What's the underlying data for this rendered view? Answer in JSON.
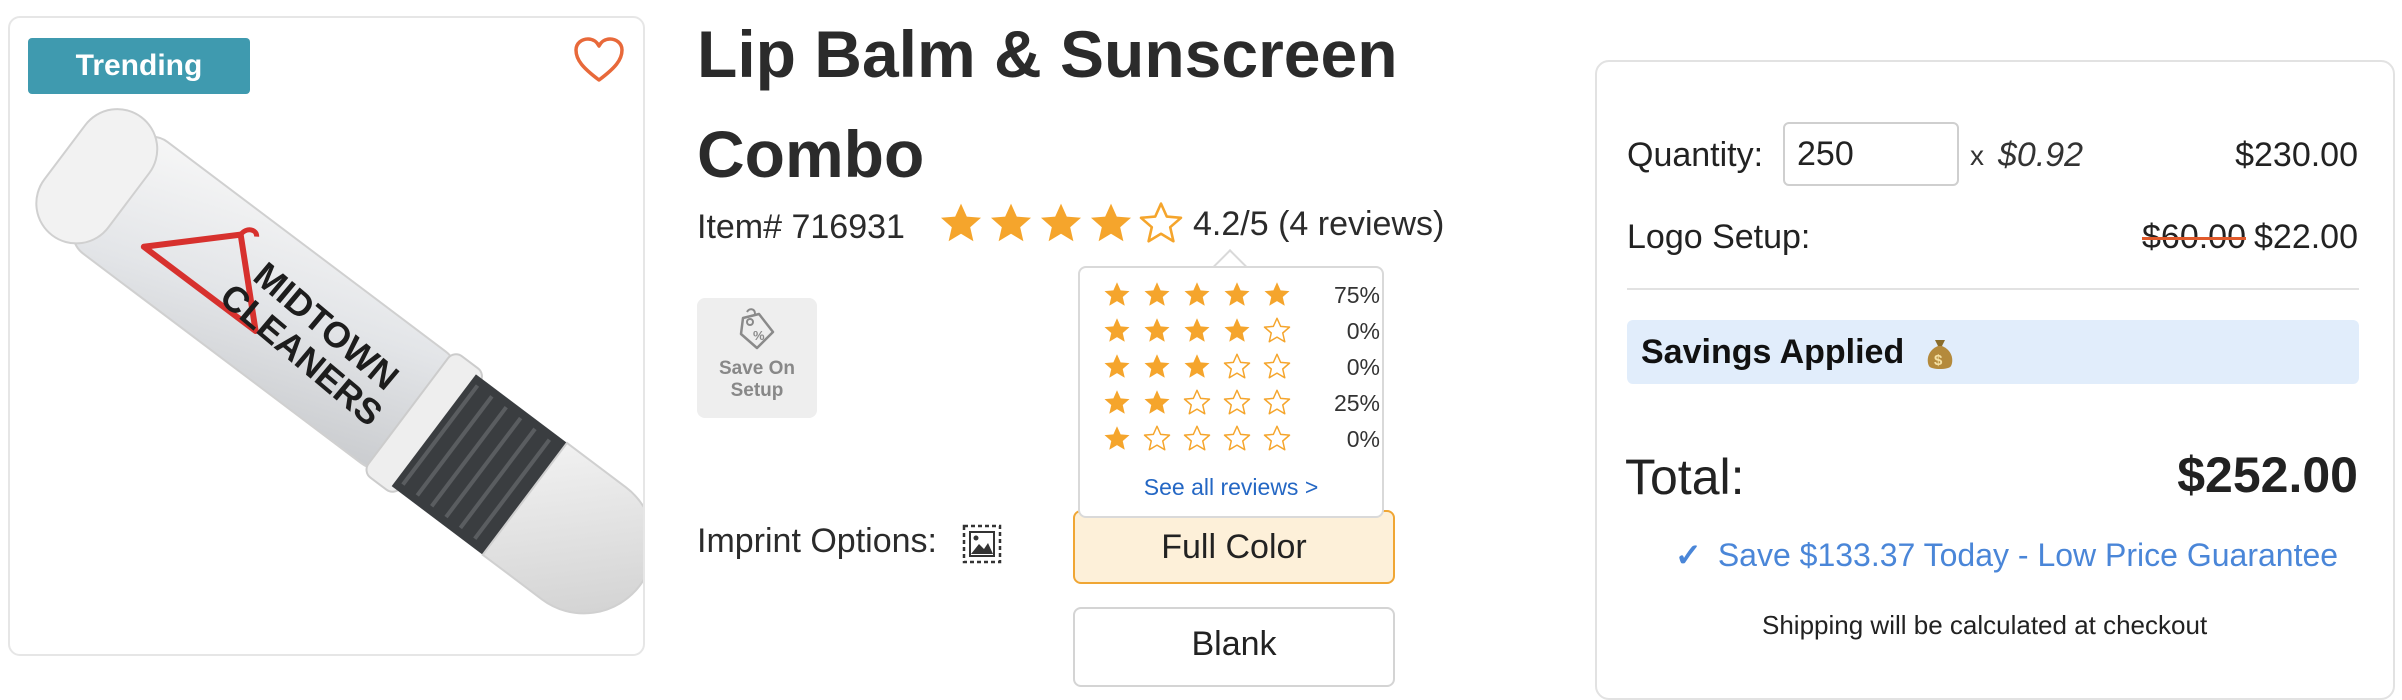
{
  "product_image": {
    "badge": "Trending",
    "imprint_text_line1": "MIDTOWN",
    "imprint_text_line2": "CLEANERS"
  },
  "title": "Lip Balm & Sunscreen Combo",
  "item_number": "Item# 716931",
  "rating": {
    "value": 4.2,
    "text": "4.2/5",
    "reviews_text": "(4 reviews)",
    "distribution": [
      {
        "stars": 5,
        "percent": "75%"
      },
      {
        "stars": 4,
        "percent": "0%"
      },
      {
        "stars": 3,
        "percent": "0%"
      },
      {
        "stars": 2,
        "percent": "25%"
      },
      {
        "stars": 1,
        "percent": "0%"
      }
    ],
    "see_all": "See all reviews >"
  },
  "setup_badge": {
    "label": "Save On Setup"
  },
  "imprint": {
    "label": "Imprint Options:",
    "options": [
      "Full Color",
      "Blank"
    ],
    "selected": "Full Color"
  },
  "pricing": {
    "quantity_label": "Quantity:",
    "quantity_value": "250",
    "times": "x",
    "unit_price": "$0.92",
    "quantity_total": "$230.00",
    "logo_label": "Logo Setup:",
    "logo_old": "$60.00",
    "logo_new": "$22.00",
    "savings_label": "Savings Applied",
    "total_label": "Total:",
    "total_value": "$252.00",
    "guarantee": "Save $133.37 Today - Low Price Guarantee",
    "shipping": "Shipping will be calculated at checkout"
  },
  "colors": {
    "badge": "#3f9aaf",
    "star": "#f5a52c",
    "heart": "#e8693a",
    "link": "#2467c4",
    "guarantee": "#4a86d8",
    "selected_option_bg": "#fdf0d9",
    "savings_bg": "#e1edfb"
  },
  "icons": {
    "heart": "heart-outline-icon",
    "setup": "price-tag-icon",
    "imprint": "image-icon",
    "savings": "money-bag-icon",
    "check": "checkmark-icon"
  }
}
